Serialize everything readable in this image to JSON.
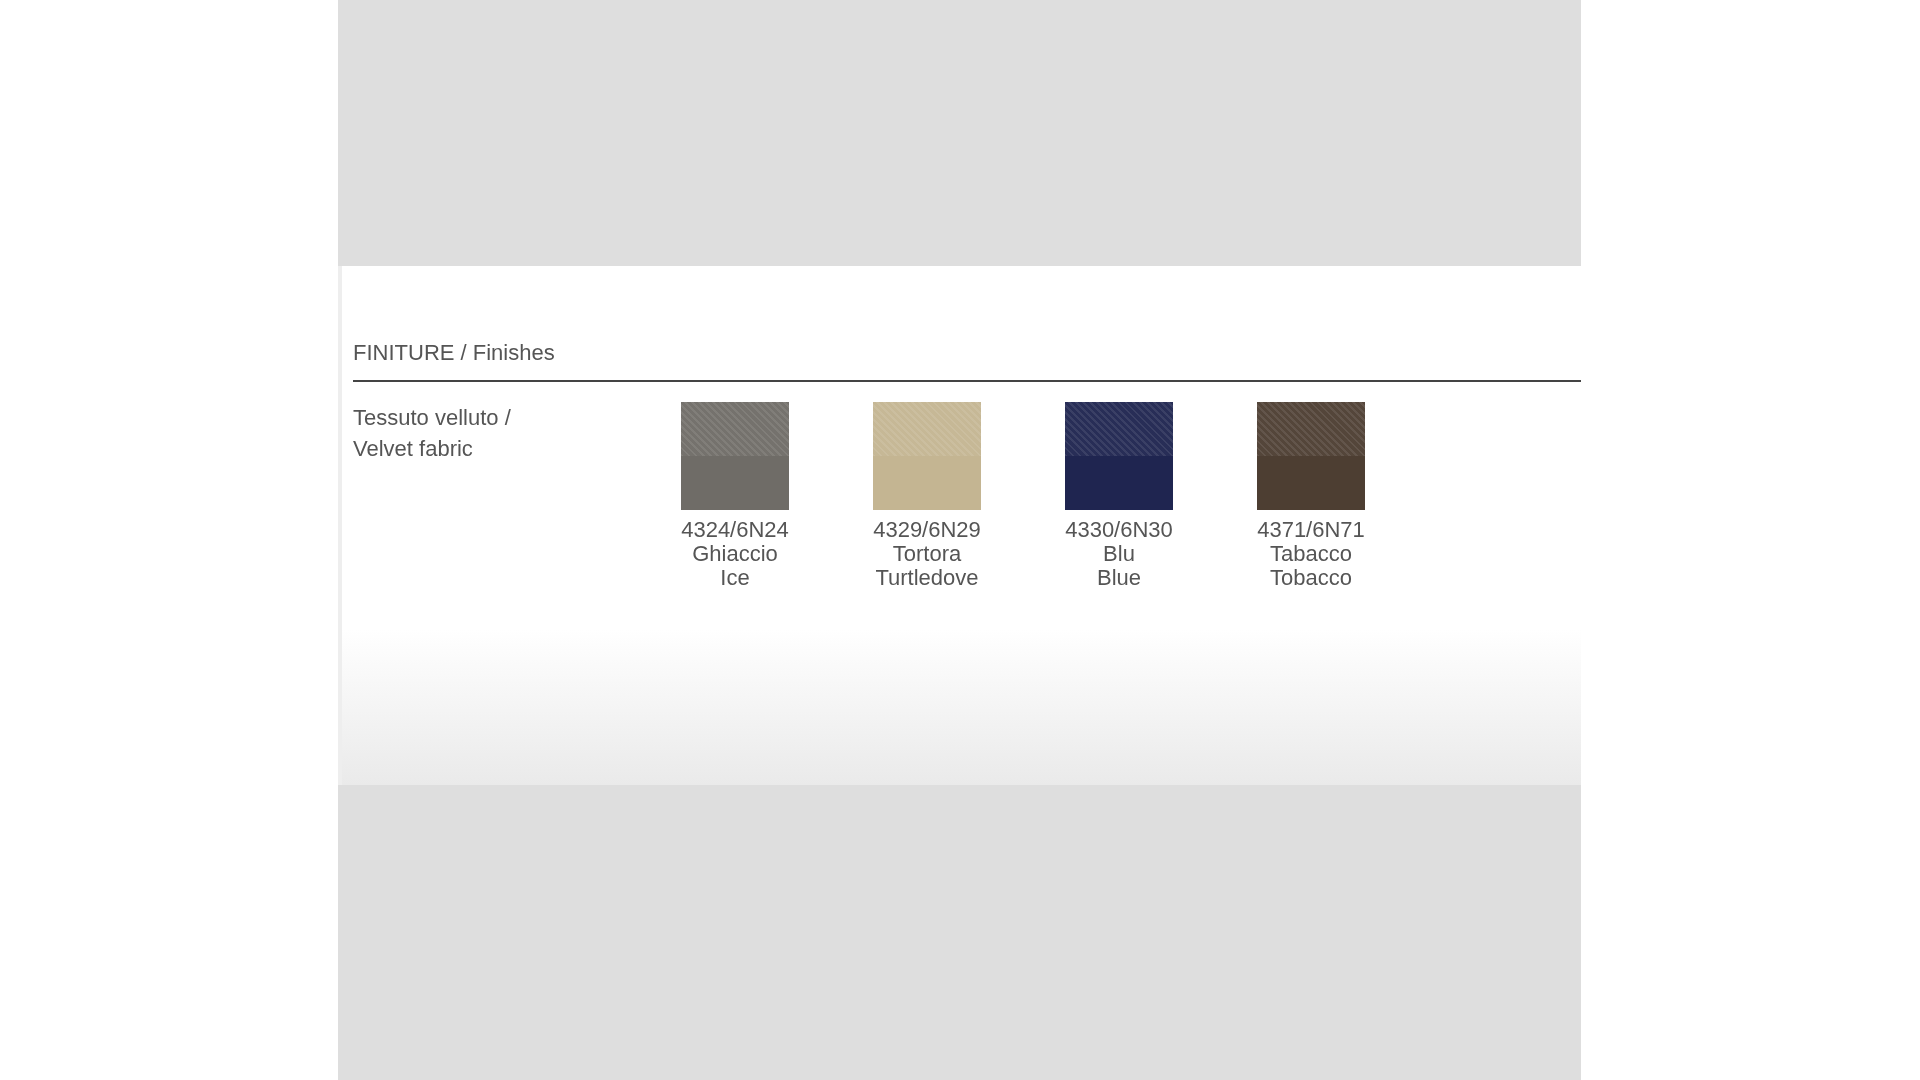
{
  "section": {
    "title": "FINITURE / Finishes",
    "rows": [
      {
        "label": "Tessuto velluto / Velvet fabric",
        "swatches": [
          {
            "code": "4324/6N24",
            "name_it": "Ghiaccio",
            "name_en": "Ice",
            "color": "#6f6c67"
          },
          {
            "code": "4329/6N29",
            "name_it": "Tortora",
            "name_en": "Turtledove",
            "color": "#c4b592"
          },
          {
            "code": "4330/6N30",
            "name_it": "Blu",
            "name_en": "Blue",
            "color": "#1f2550"
          },
          {
            "code": "4371/6N71",
            "name_it": "Tabacco",
            "name_en": "Tobacco",
            "color": "#4d3e32"
          }
        ]
      }
    ]
  }
}
